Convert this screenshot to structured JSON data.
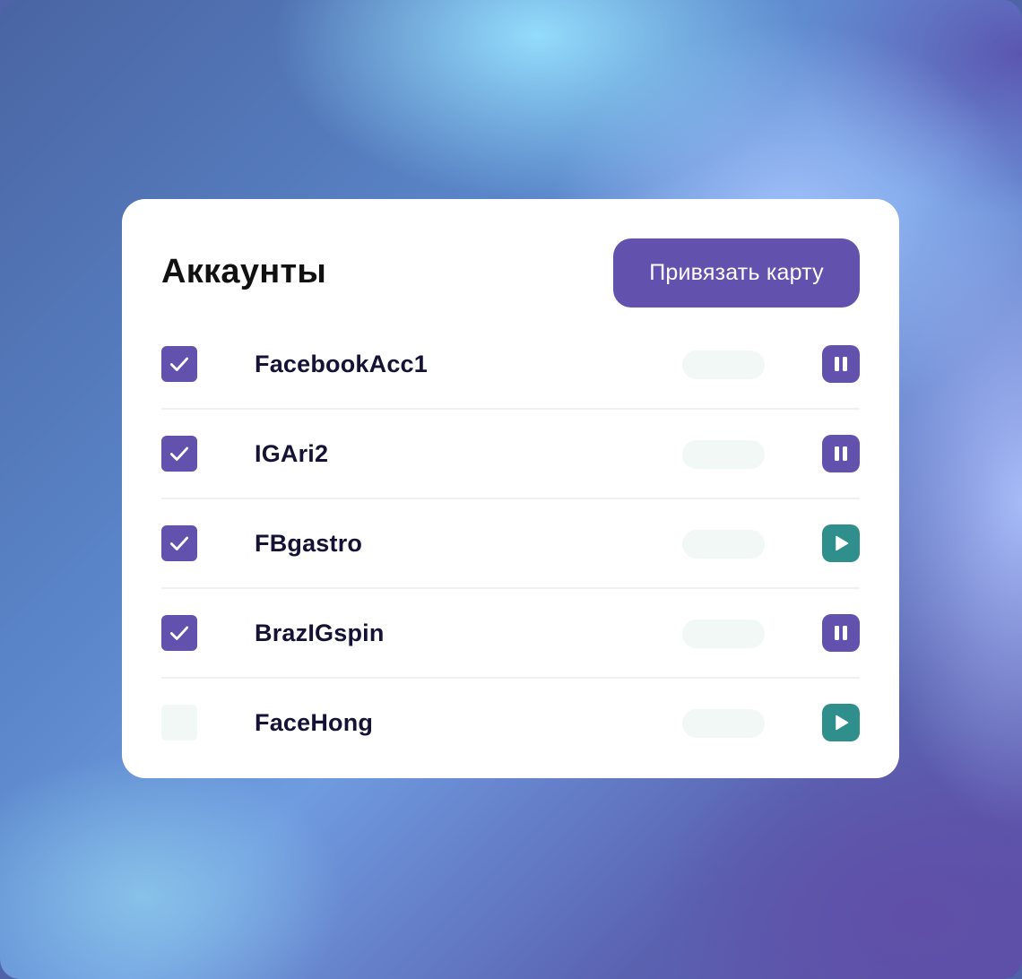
{
  "header": {
    "title": "Аккаунты",
    "bind_card_label": "Привязать карту"
  },
  "accounts": [
    {
      "name": "FacebookAcc1",
      "checked": true,
      "action": "pause"
    },
    {
      "name": "IGAri2",
      "checked": true,
      "action": "pause"
    },
    {
      "name": "FBgastro",
      "checked": true,
      "action": "play"
    },
    {
      "name": "BrazIGspin",
      "checked": true,
      "action": "pause"
    },
    {
      "name": "FaceHong",
      "checked": false,
      "action": "play"
    }
  ],
  "icons": {
    "checked": "check-icon",
    "pause": "pause-icon",
    "play": "play-icon"
  },
  "colors": {
    "accent": "#6252ad",
    "play": "#2e8f8c",
    "placeholder": "#f1f8f6",
    "text": "#151235"
  }
}
